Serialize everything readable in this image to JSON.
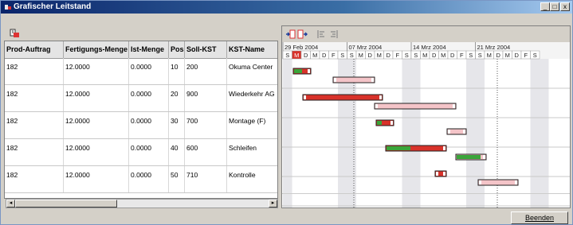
{
  "window": {
    "title": "Grafischer Leitstand",
    "controls": {
      "minimize": "_",
      "maximize": "□",
      "close": "x"
    }
  },
  "table": {
    "columns": [
      "Prod-Auftrag",
      "Fertigungs-Menge",
      "Ist-Menge",
      "Pos",
      "Soll-KST",
      "KST-Name"
    ],
    "rows": [
      [
        "182",
        "12.0000",
        "0.0000",
        "10",
        "200",
        "Okuma Center"
      ],
      [
        "182",
        "12.0000",
        "0.0000",
        "20",
        "900",
        "Wiederkehr AG"
      ],
      [
        "182",
        "12.0000",
        "0.0000",
        "30",
        "700",
        "Montage (F)"
      ],
      [
        "182",
        "12.0000",
        "0.0000",
        "40",
        "600",
        "Schleifen"
      ],
      [
        "182",
        "12.0000",
        "0.0000",
        "50",
        "710",
        "Kontrolle"
      ]
    ]
  },
  "gantt": {
    "weeks": [
      "29 Feb 2004",
      "07 Mrz 2004",
      "14 Mrz 2004",
      "21 Mrz 2004"
    ],
    "day_letters": [
      "S",
      "M",
      "D",
      "M",
      "D",
      "F",
      "S"
    ],
    "highlight_day": "M",
    "colors": {
      "red": "#d8322a",
      "pink": "#f4c4c8",
      "green": "#3aa53a",
      "weekend": "#e6e6ea"
    }
  },
  "footer": {
    "close_button": "Beenden"
  }
}
